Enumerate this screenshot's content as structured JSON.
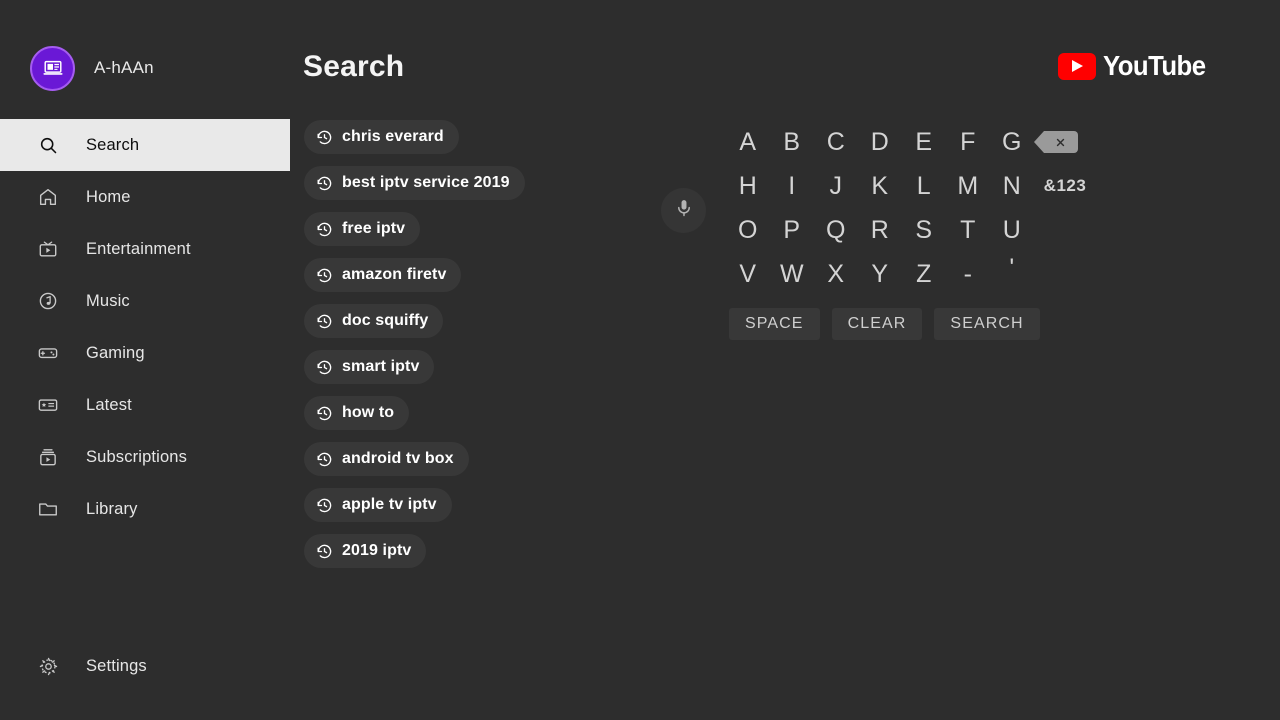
{
  "account": {
    "name": "A-hAAn",
    "avatar_icon": "laptop-icon",
    "avatar_bg": "#6a18d6",
    "avatar_ring": "#a55cf0"
  },
  "header": {
    "title": "Search",
    "brand": "YouTube",
    "brand_color": "#ff0000"
  },
  "sidebar": {
    "items": [
      {
        "label": "Search",
        "icon": "search-icon",
        "selected": true
      },
      {
        "label": "Home",
        "icon": "home-icon",
        "selected": false
      },
      {
        "label": "Entertainment",
        "icon": "tv-icon",
        "selected": false
      },
      {
        "label": "Music",
        "icon": "music-note-icon",
        "selected": false
      },
      {
        "label": "Gaming",
        "icon": "gamepad-icon",
        "selected": false
      },
      {
        "label": "Latest",
        "icon": "news-card-icon",
        "selected": false
      },
      {
        "label": "Subscriptions",
        "icon": "subscriptions-icon",
        "selected": false
      },
      {
        "label": "Library",
        "icon": "folder-icon",
        "selected": false
      }
    ],
    "settings": {
      "label": "Settings",
      "icon": "gear-icon"
    },
    "selected_bg": "#e9e9e9",
    "selected_text": "#0e0e0e"
  },
  "suggestions": {
    "icon": "history-icon",
    "items": [
      "chris everard",
      "best iptv service 2019",
      "free iptv",
      "amazon firetv",
      "doc squiffy",
      "smart iptv",
      "how to",
      "android tv box",
      "apple tv iptv",
      "2019 iptv"
    ]
  },
  "voice": {
    "icon": "microphone-icon",
    "label": ""
  },
  "keyboard": {
    "rows": [
      [
        "A",
        "B",
        "C",
        "D",
        "E",
        "F",
        "G"
      ],
      [
        "H",
        "I",
        "J",
        "K",
        "L",
        "M",
        "N"
      ],
      [
        "O",
        "P",
        "Q",
        "R",
        "S",
        "T",
        "U"
      ],
      [
        "V",
        "W",
        "X",
        "Y",
        "Z",
        "-",
        "'"
      ]
    ],
    "backspace_icon": "backspace-icon",
    "symbols_key": "&123",
    "actions": [
      "SPACE",
      "CLEAR",
      "SEARCH"
    ]
  }
}
